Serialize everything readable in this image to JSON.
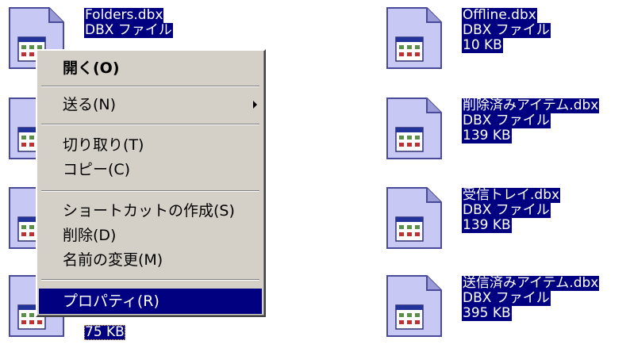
{
  "files": [
    {
      "name": "Folders.dbx",
      "type": "DBX ファイル",
      "size": ""
    },
    {
      "name": "",
      "type": "",
      "size": ""
    },
    {
      "name": "",
      "type": "",
      "size": ""
    },
    {
      "name": "",
      "type": "",
      "size": "75 KB"
    },
    {
      "name": "Offline.dbx",
      "type": "DBX ファイル",
      "size": "10 KB"
    },
    {
      "name": "削除済みアイテム.dbx",
      "type": "DBX ファイル",
      "size": "139 KB"
    },
    {
      "name": "受信トレイ.dbx",
      "type": "DBX ファイル",
      "size": "139 KB"
    },
    {
      "name": "送信済みアイテム.dbx",
      "type": "DBX ファイル",
      "size": "395 KB"
    }
  ],
  "context_menu": {
    "open": "開く(O)",
    "send_to": "送る(N)",
    "cut": "切り取り(T)",
    "copy": "コピー(C)",
    "create_shortcut": "ショートカットの作成(S)",
    "delete": "削除(D)",
    "rename": "名前の変更(M)",
    "properties": "プロパティ(R)"
  },
  "colors": {
    "selection": "#000080",
    "menu_face": "#d4d0c8",
    "icon_face": "#c8c8f4"
  },
  "icon": "dbx-file-icon"
}
